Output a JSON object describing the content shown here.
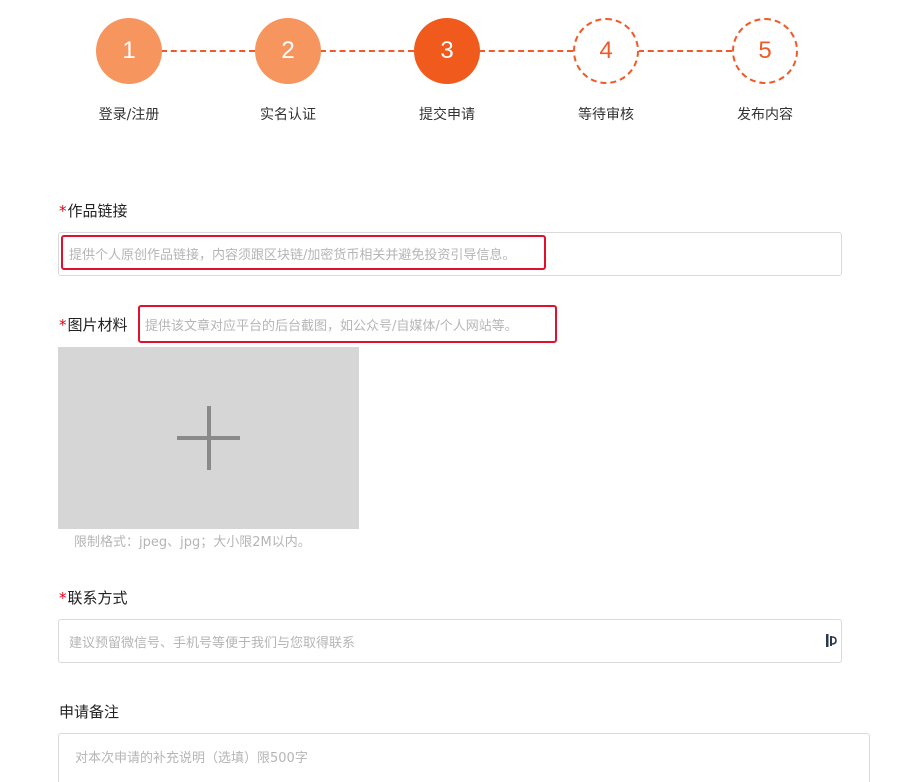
{
  "steps": [
    {
      "number": "1",
      "label": "登录/注册",
      "state": "done"
    },
    {
      "number": "2",
      "label": "实名认证",
      "state": "done"
    },
    {
      "number": "3",
      "label": "提交申请",
      "state": "active"
    },
    {
      "number": "4",
      "label": "等待审核",
      "state": "todo"
    },
    {
      "number": "5",
      "label": "发布内容",
      "state": "todo"
    }
  ],
  "form": {
    "required_mark": "*",
    "work_link": {
      "label": "作品链接",
      "placeholder": "提供个人原创作品链接，内容须跟区块链/加密货币相关并避免投资引导信息。"
    },
    "images": {
      "label": "图片材料",
      "description": "提供该文章对应平台的后台截图，如公众号/自媒体/个人网站等。",
      "upload_hint": "限制格式：jpeg、jpg；大小限2M以内。"
    },
    "contact": {
      "label": "联系方式",
      "placeholder": "建议预留微信号、手机号等便于我们与您取得联系"
    },
    "remarks": {
      "label": "申请备注",
      "placeholder": "对本次申请的补充说明（选填）限500字"
    }
  },
  "colors": {
    "step_done": "#f7955f",
    "step_active": "#f05a1c",
    "step_todo_border": "#f05a28",
    "required": "#e60012",
    "highlight_box": "#e0102e"
  }
}
